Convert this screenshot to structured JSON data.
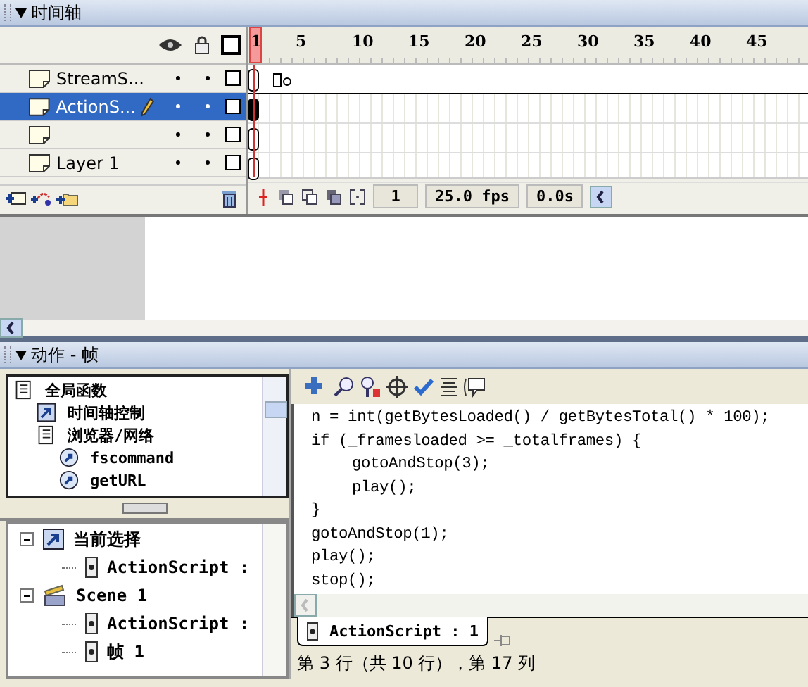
{
  "timeline": {
    "title": "时间轴",
    "ruler": [
      "1",
      "5",
      "10",
      "15",
      "20",
      "25",
      "30",
      "35",
      "40",
      "45"
    ],
    "layers": [
      {
        "name": "StreamS...",
        "selected": false,
        "frames": [
          {
            "kind": "keyframe"
          },
          {
            "kind": "span"
          },
          {
            "kind": "end"
          },
          {
            "kind": "blank"
          }
        ]
      },
      {
        "name": "ActionS...",
        "selected": true,
        "frames": [
          {
            "kind": "keyframe"
          }
        ]
      },
      {
        "selected": false,
        "frames": [
          {
            "kind": "keyframe"
          }
        ]
      },
      {
        "name": "Layer 1",
        "selected": false,
        "frames": [
          {
            "kind": "keyframe"
          }
        ]
      }
    ],
    "frame_info": {
      "current_frame": "1",
      "frame_rate": "25.0 fps",
      "elapsed_time": "0.0s"
    }
  },
  "actions": {
    "title": "动作 - 帧",
    "toolbox": [
      {
        "label": "全局函数",
        "kind": "book",
        "children": [
          {
            "label": "时间轴控制",
            "kind": "action"
          },
          {
            "label": "浏览器/网络",
            "kind": "book",
            "children": [
              {
                "label": "fscommand",
                "kind": "function"
              },
              {
                "label": "getURL",
                "kind": "function"
              }
            ]
          }
        ]
      }
    ],
    "navigator": [
      {
        "label": "当前选择",
        "kind": "action",
        "children": [
          {
            "label": "ActionScript :",
            "kind": "script"
          }
        ]
      },
      {
        "label": "Scene 1",
        "kind": "scene",
        "children": [
          {
            "label": "ActionScript :",
            "kind": "script"
          },
          {
            "label": "帧 1",
            "kind": "script"
          }
        ]
      }
    ],
    "code": [
      {
        "text": "n = int(getBytesLoaded() / getBytesTotal() * 100);",
        "indent": false
      },
      {
        "text": "if (_framesloaded >= _totalframes) {",
        "indent": false
      },
      {
        "text": "gotoAndStop(3);",
        "indent": true
      },
      {
        "text": "play();",
        "indent": true
      },
      {
        "text": "}",
        "indent": false
      },
      {
        "text": "gotoAndStop(1);",
        "indent": false
      },
      {
        "text": "play();",
        "indent": false
      },
      {
        "text": "stop();",
        "indent": false
      }
    ],
    "script_tab": "ActionScript : 1",
    "status": "第 3 行（共 10 行），第 17 列"
  }
}
